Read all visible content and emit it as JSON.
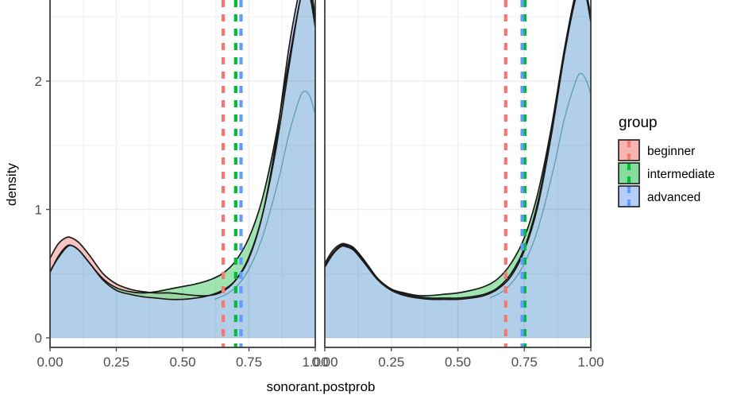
{
  "chart_data": {
    "type": "area",
    "title": "",
    "xlabel": "sonorant.postprob",
    "ylabel": "density",
    "xlim": [
      0.0,
      1.0
    ],
    "ylim": [
      0.0,
      2.72
    ],
    "grid": true,
    "x_ticks": [
      "0.00",
      "0.25",
      "0.50",
      "0.75",
      "1.00"
    ],
    "x_tick_values": [
      0.0,
      0.25,
      0.5,
      0.75,
      1.0
    ],
    "y_ticks": [
      "0",
      "1",
      "2"
    ],
    "y_tick_values": [
      0,
      1,
      2
    ],
    "legend": {
      "title": "group",
      "position": "right",
      "entries": [
        {
          "label": "beginner",
          "fill": "#f8b4b0",
          "line": "#f8766d"
        },
        {
          "label": "intermediate",
          "fill": "#86dd9e",
          "line": "#00ba38"
        },
        {
          "label": "advanced",
          "fill": "#b6cdf9",
          "line": "#619cff"
        }
      ]
    },
    "panels": [
      {
        "name": "panel-left",
        "series": [
          {
            "name": "beginner",
            "fill": "#f8b4b0",
            "x": [
              0.0,
              0.03,
              0.06,
              0.08,
              0.11,
              0.15,
              0.2,
              0.25,
              0.3,
              0.35,
              0.4,
              0.45,
              0.5,
              0.55,
              0.6,
              0.65,
              0.7,
              0.75,
              0.8,
              0.85,
              0.9,
              0.94,
              0.96,
              0.98,
              1.0
            ],
            "y": [
              0.62,
              0.73,
              0.78,
              0.78,
              0.74,
              0.64,
              0.5,
              0.42,
              0.38,
              0.36,
              0.35,
              0.35,
              0.34,
              0.33,
              0.33,
              0.36,
              0.45,
              0.63,
              0.95,
              1.45,
              2.1,
              2.6,
              2.72,
              2.68,
              2.45
            ]
          },
          {
            "name": "intermediate",
            "fill": "#86dd9e",
            "x": [
              0.0,
              0.03,
              0.06,
              0.08,
              0.11,
              0.15,
              0.2,
              0.25,
              0.3,
              0.35,
              0.4,
              0.45,
              0.5,
              0.55,
              0.6,
              0.65,
              0.7,
              0.75,
              0.8,
              0.85,
              0.9,
              0.94,
              0.96,
              0.98,
              1.0
            ],
            "y": [
              0.52,
              0.62,
              0.7,
              0.72,
              0.68,
              0.58,
              0.46,
              0.39,
              0.36,
              0.35,
              0.36,
              0.38,
              0.4,
              0.42,
              0.45,
              0.5,
              0.6,
              0.78,
              1.08,
              1.55,
              2.15,
              2.6,
              2.72,
              2.66,
              2.42
            ]
          },
          {
            "name": "advanced",
            "fill": "#b6cdf9",
            "x": [
              0.0,
              0.03,
              0.06,
              0.08,
              0.11,
              0.15,
              0.2,
              0.25,
              0.3,
              0.35,
              0.4,
              0.45,
              0.5,
              0.55,
              0.6,
              0.65,
              0.7,
              0.75,
              0.8,
              0.85,
              0.9,
              0.94,
              0.96,
              0.98,
              1.0
            ],
            "y": [
              0.51,
              0.63,
              0.71,
              0.72,
              0.68,
              0.58,
              0.45,
              0.37,
              0.34,
              0.32,
              0.31,
              0.3,
              0.3,
              0.31,
              0.33,
              0.37,
              0.45,
              0.62,
              0.95,
              1.5,
              2.25,
              2.7,
              2.82,
              2.76,
              2.5
            ]
          }
        ],
        "vlines": [
          {
            "group": "beginner",
            "x": 0.653,
            "color": "#f8766d"
          },
          {
            "group": "intermediate",
            "x": 0.7,
            "color": "#00ba38"
          },
          {
            "group": "advanced",
            "x": 0.72,
            "color": "#619cff"
          }
        ]
      },
      {
        "name": "panel-right",
        "series": [
          {
            "name": "beginner",
            "fill": "#f8b4b0",
            "x": [
              0.0,
              0.03,
              0.06,
              0.08,
              0.11,
              0.15,
              0.2,
              0.25,
              0.3,
              0.35,
              0.4,
              0.45,
              0.5,
              0.55,
              0.6,
              0.65,
              0.7,
              0.75,
              0.8,
              0.85,
              0.9,
              0.94,
              0.96,
              0.98,
              1.0
            ],
            "y": [
              0.58,
              0.68,
              0.73,
              0.73,
              0.7,
              0.6,
              0.46,
              0.38,
              0.34,
              0.32,
              0.31,
              0.31,
              0.31,
              0.32,
              0.34,
              0.39,
              0.5,
              0.7,
              1.05,
              1.58,
              2.22,
              2.64,
              2.74,
              2.7,
              2.48
            ]
          },
          {
            "name": "intermediate",
            "fill": "#86dd9e",
            "x": [
              0.0,
              0.03,
              0.06,
              0.08,
              0.11,
              0.15,
              0.2,
              0.25,
              0.3,
              0.35,
              0.4,
              0.45,
              0.5,
              0.55,
              0.6,
              0.65,
              0.7,
              0.75,
              0.8,
              0.85,
              0.9,
              0.94,
              0.96,
              0.98,
              1.0
            ],
            "y": [
              0.56,
              0.66,
              0.72,
              0.72,
              0.69,
              0.59,
              0.46,
              0.38,
              0.35,
              0.33,
              0.33,
              0.34,
              0.35,
              0.37,
              0.4,
              0.46,
              0.58,
              0.78,
              1.12,
              1.62,
              2.24,
              2.66,
              2.76,
              2.72,
              2.5
            ]
          },
          {
            "name": "advanced",
            "fill": "#b6cdf9",
            "x": [
              0.0,
              0.03,
              0.06,
              0.08,
              0.11,
              0.15,
              0.2,
              0.25,
              0.3,
              0.35,
              0.4,
              0.45,
              0.5,
              0.55,
              0.6,
              0.65,
              0.7,
              0.75,
              0.8,
              0.85,
              0.9,
              0.94,
              0.96,
              0.98,
              1.0
            ],
            "y": [
              0.55,
              0.65,
              0.71,
              0.71,
              0.68,
              0.58,
              0.45,
              0.37,
              0.33,
              0.31,
              0.3,
              0.3,
              0.3,
              0.31,
              0.33,
              0.38,
              0.48,
              0.68,
              1.02,
              1.56,
              2.2,
              2.62,
              2.72,
              2.68,
              2.46
            ]
          }
        ],
        "vlines": [
          {
            "group": "beginner",
            "x": 0.68,
            "color": "#f8766d"
          },
          {
            "group": "intermediate",
            "x": 0.752,
            "color": "#00ba38"
          },
          {
            "group": "advanced",
            "x": 0.742,
            "color": "#619cff"
          }
        ]
      }
    ],
    "inner_overlap_curves": {
      "description": "lower teal sub-curve visible within the overlap of the main peak",
      "panel_left": {
        "x": [
          0.62,
          0.68,
          0.74,
          0.8,
          0.86,
          0.9,
          0.94,
          0.96,
          0.98,
          1.0
        ],
        "y": [
          0.3,
          0.36,
          0.5,
          0.78,
          1.22,
          1.58,
          1.86,
          1.92,
          1.88,
          1.74
        ]
      },
      "panel_right": {
        "x": [
          0.62,
          0.68,
          0.74,
          0.8,
          0.86,
          0.9,
          0.94,
          0.96,
          0.98,
          1.0
        ],
        "y": [
          0.31,
          0.38,
          0.54,
          0.84,
          1.32,
          1.7,
          1.98,
          2.06,
          2.02,
          1.9
        ]
      }
    },
    "colors": {
      "overlap_teal": "#6eb3c0",
      "panel_border": "#333333",
      "gridline_major": "#ededed",
      "gridline_minor": "#f5f5f5",
      "plot_background": "#ffffff",
      "curve_outline": "#1a1a1a"
    }
  }
}
